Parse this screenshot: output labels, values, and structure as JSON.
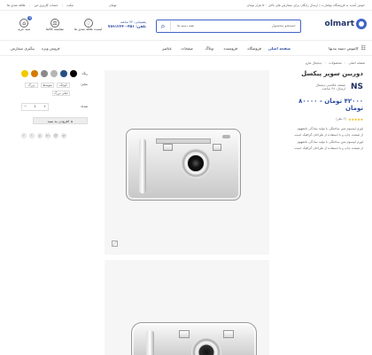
{
  "topbar": {
    "announcement": "خوش آمدید به فروشگاه بولمارت | ارسال رایگان برای سفارش های بالای ۵۰۰ هزار تومان",
    "menu_items": [
      "تیکت",
      "حساب کاربری من",
      "علاقه مندی ها"
    ],
    "currency": "تومان"
  },
  "header": {
    "logo_text": "olmart",
    "search_placeholder": "جستجو محصول",
    "search_category": "همه دسته ها",
    "phone_label": "پشتیبانی: ۲۴ ساعته",
    "phone_number": "تلفن: ۴۵۶-۷۸۹۱۲۳۴۰",
    "icons": [
      "لیست علاقه مندی ها",
      "مقایسه کالاها",
      "سبد خرید"
    ],
    "cart_count": "0"
  },
  "nav": {
    "category_button": "کاتیوش دسته بندیها",
    "items": [
      "صفحه اصلی",
      "فروشگاه",
      "فروشنده",
      "وبلاگ",
      "صفحات",
      "عناصر"
    ],
    "right_links": [
      "فروش ویژه",
      "پیگیری سفارش"
    ]
  },
  "breadcrumb": {
    "items": [
      "صفحه اصلی",
      "محصولات",
      "دیجیتال هارو"
    ]
  },
  "product": {
    "title": "دوربین سوپر پیکسل",
    "brand_lines": [
      "صفحه عکاسی دیجیتال",
      "ارسال: ۴۸ ساعت"
    ],
    "brand_logo": "NS",
    "price": "۴۲۰۰۰ تومان - ۸۰۰۰۰ تومان",
    "rating_text": "(۲ نظر)",
    "description": [
      "لورم ایپسوم متن ساختگی با تولید سادگی نامفهوم",
      "از صنعت چاپ و با استفاده از طراحان گرافیک است.",
      "لورم ایپسوم متن ساختگی با تولید سادگی نامفهوم",
      "از صنعت چاپ و با استفاده از طراحان گرافیک است."
    ]
  },
  "options": {
    "color_label": "رنگ:",
    "colors": [
      "#f2c800",
      "#d47a00",
      "#8a8a8a",
      "#b5b5b5",
      "#244f83",
      "#000000"
    ],
    "size_label": "سایز:",
    "sizes": [
      "کوچک",
      "متوسط",
      "بزرگ"
    ],
    "size_extra": "خیلی بزرگ",
    "quantity_label": "تعداد:",
    "quantity": "1",
    "add_to_cart": "افزودن به سبد"
  },
  "share": {
    "icons": [
      "facebook-icon",
      "twitter-icon",
      "pinterest-icon",
      "linkedin-icon",
      "mail-icon",
      "whatsapp-icon"
    ]
  }
}
